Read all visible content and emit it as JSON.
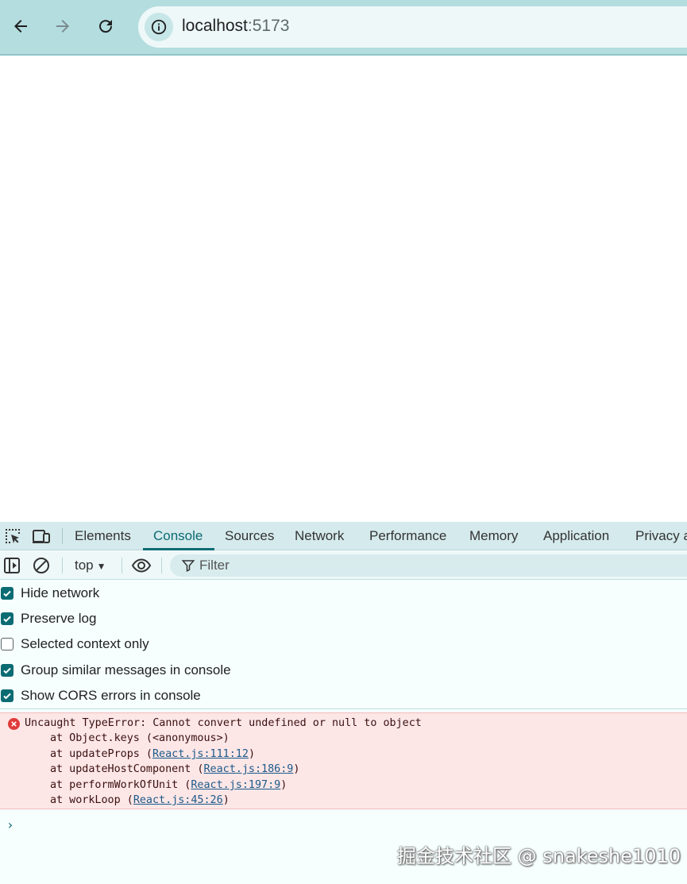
{
  "browser": {
    "url_host": "localhost",
    "url_port": ":5173"
  },
  "devtools": {
    "tabs": [
      "Elements",
      "Console",
      "Sources",
      "Network",
      "Performance",
      "Memory",
      "Application",
      "Privacy a"
    ],
    "active_tab": "Console",
    "context": "top",
    "filter_placeholder": "Filter",
    "settings": [
      {
        "label": "Hide network",
        "checked": true
      },
      {
        "label": "Preserve log",
        "checked": true
      },
      {
        "label": "Selected context only",
        "checked": false
      },
      {
        "label": "Group similar messages in console",
        "checked": true
      },
      {
        "label": "Show CORS errors in console",
        "checked": true
      }
    ],
    "error": {
      "message": "Uncaught TypeError: Cannot convert undefined or null to object",
      "stack": [
        {
          "prefix": "at Object.keys (<anonymous>)",
          "link": "",
          "suffix": ""
        },
        {
          "prefix": "at updateProps (",
          "link": "React.js:111:12",
          "suffix": ")"
        },
        {
          "prefix": "at updateHostComponent (",
          "link": "React.js:186:9",
          "suffix": ")"
        },
        {
          "prefix": "at performWorkOfUnit (",
          "link": "React.js:197:9",
          "suffix": ")"
        },
        {
          "prefix": "at workLoop (",
          "link": "React.js:45:26",
          "suffix": ")"
        }
      ]
    },
    "prompt_symbol": "›"
  },
  "watermark": "掘金技术社区 @ snakeshe1010",
  "colors": {
    "accent": "#0b6b73",
    "error_bg": "#fde6e6",
    "error_icon": "#e03b3b"
  }
}
